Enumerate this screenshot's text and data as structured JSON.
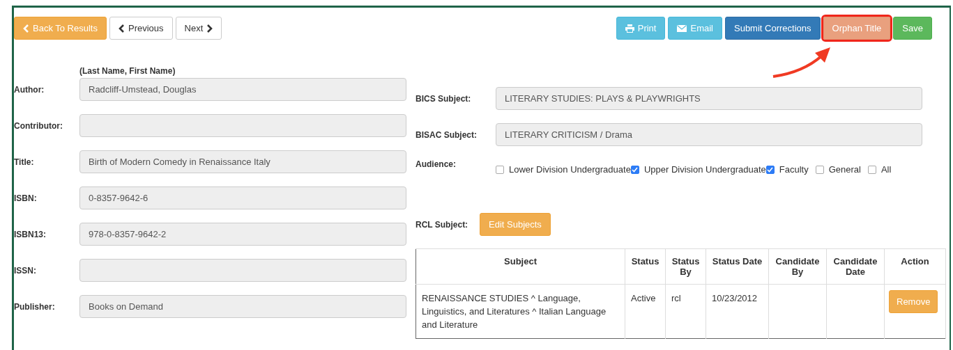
{
  "toolbar_left": [
    {
      "kind": "back",
      "label": "Back To Results"
    },
    {
      "kind": "previous",
      "label": "Previous"
    },
    {
      "kind": "next",
      "label": "Next"
    }
  ],
  "toolbar_right": [
    {
      "kind": "print",
      "label": "Print",
      "highlighted": false
    },
    {
      "kind": "email",
      "label": "Email",
      "highlighted": false
    },
    {
      "kind": "submit",
      "label": "Submit Corrections",
      "highlighted": false
    },
    {
      "kind": "orphan",
      "label": "Orphan Title",
      "highlighted": true
    },
    {
      "kind": "save",
      "label": "Save",
      "highlighted": false
    }
  ],
  "left_fields": [
    {
      "label": "Author:",
      "hint": "(Last Name, First Name)",
      "value": "Radcliff-Umstead, Douglas"
    },
    {
      "label": "Contributor:"
    },
    {
      "label": "Title:",
      "value": "Birth of Modern Comedy in Renaissance Italy"
    },
    {
      "label": "ISBN:",
      "value": "0-8357-9642-6"
    },
    {
      "label": "ISBN13:",
      "value": "978-0-8357-9642-2"
    },
    {
      "label": "ISSN:"
    },
    {
      "label": "Publisher:",
      "value": "Books on Demand"
    }
  ],
  "subject_fields": [
    {
      "label": "BICS Subject:",
      "value": "LITERARY STUDIES: PLAYS & PLAYWRIGHTS"
    },
    {
      "label": "BISAC Subject:",
      "value": "LITERARY CRITICISM / Drama"
    }
  ],
  "audience": {
    "label": "Audience:",
    "options": [
      {
        "label": "Lower Division Undergraduate",
        "checked": false
      },
      {
        "label": "Upper Division Undergraduate",
        "checked": true
      },
      {
        "label": "Faculty",
        "checked": true
      },
      {
        "label": "General",
        "checked": false
      },
      {
        "label": "All",
        "checked": false
      }
    ]
  },
  "rcl": {
    "label": "RCL Subject:",
    "button": "Edit Subjects"
  },
  "table": {
    "columns": [
      "Subject",
      "Status",
      "Status By",
      "Status Date",
      "Candidate By",
      "Candidate Date",
      "Action"
    ],
    "rows": [
      {
        "subject": "RENAISSANCE STUDIES ^ Language, Linguistics, and Literatures ^ Italian Language and Literature",
        "status": "Active",
        "status_by": "rcl",
        "status_date": "10/23/2012",
        "action": "Remove"
      }
    ]
  }
}
